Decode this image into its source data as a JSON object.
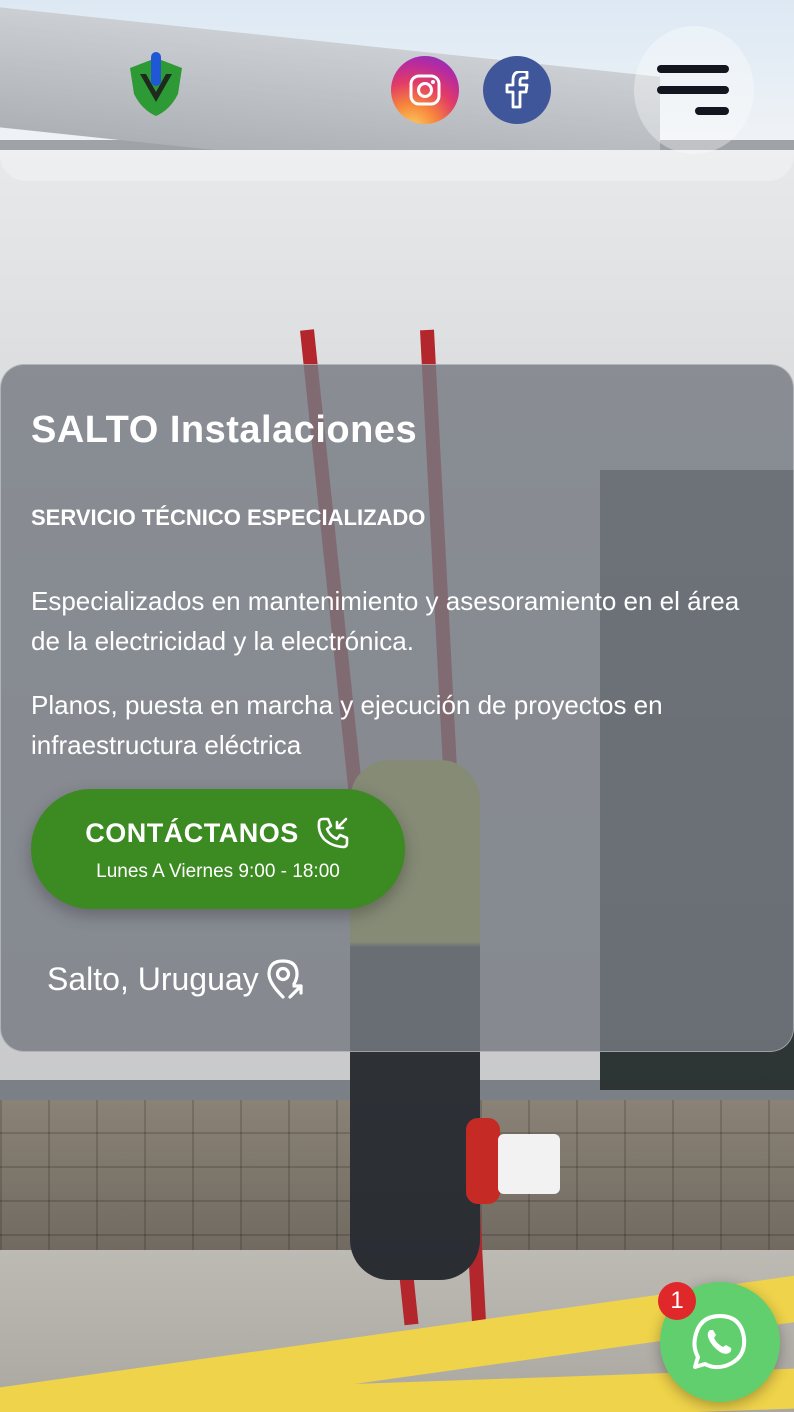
{
  "header": {
    "logo_icon": "shield-logo-icon",
    "social": [
      {
        "name": "instagram",
        "icon": "instagram-icon"
      },
      {
        "name": "facebook",
        "icon": "facebook-icon"
      }
    ],
    "menu_icon": "hamburger-menu-icon"
  },
  "hero": {
    "title": "SALTO Instalaciones",
    "subtitle": "SERVICIO TÉCNICO ESPECIALIZADO",
    "description_1": "Especializados en mantenimiento y asesoramiento en el área de la electricidad y la electrónica.",
    "description_2": "Planos, puesta en marcha y ejecución de proyectos en infraestructura eléctrica",
    "cta": {
      "label": "CONTÁCTANOS",
      "hours": "Lunes A Viernes 9:00 - 18:00",
      "icon": "phone-incoming-icon"
    },
    "location": {
      "text": "Salto, Uruguay",
      "icon": "map-pin-icon"
    }
  },
  "whatsapp": {
    "badge_count": "1",
    "icon": "whatsapp-icon"
  },
  "colors": {
    "cta_green": "#3c8a22",
    "whatsapp_green": "#62cf6f",
    "badge_red": "#e0272a",
    "facebook_blue": "#3f579a",
    "card_overlay": "#767b83"
  }
}
